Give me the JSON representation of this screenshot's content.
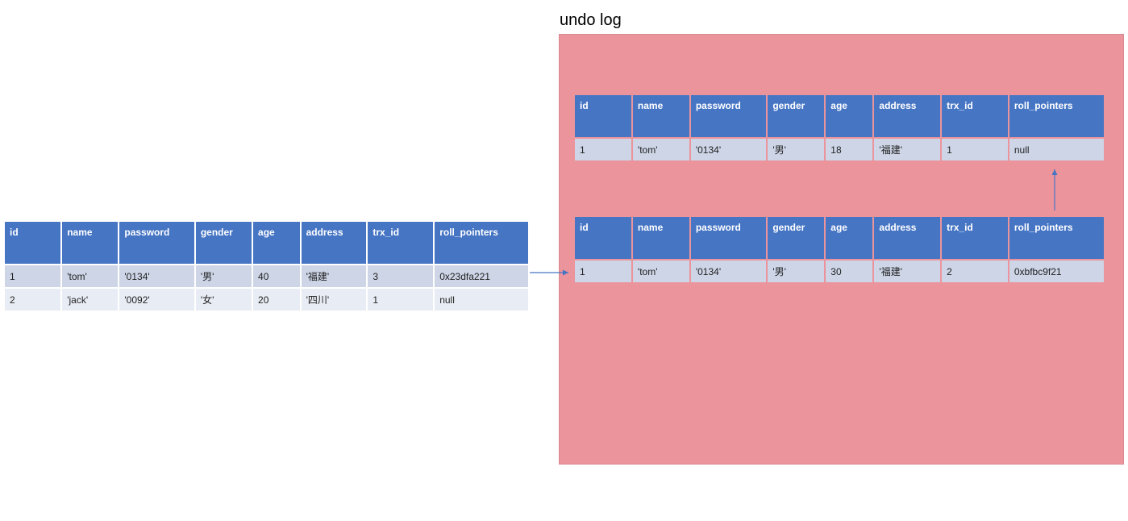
{
  "undo_log_title": "undo log",
  "columns": [
    "id",
    "name",
    "password",
    "gender",
    "age",
    "address",
    "trx_id",
    "roll_pointers"
  ],
  "main_table": {
    "rows": [
      {
        "id": "1",
        "name": "'tom'",
        "password": "'0134'",
        "gender": "'男'",
        "age": "40",
        "address": "'福建'",
        "trx_id": "3",
        "roll_pointers": "0x23dfa221"
      },
      {
        "id": "2",
        "name": "'jack'",
        "password": "'0092'",
        "gender": "'女'",
        "age": "20",
        "address": "'四川'",
        "trx_id": "1",
        "roll_pointers": "null"
      }
    ]
  },
  "undo_table_1": {
    "rows": [
      {
        "id": "1",
        "name": "'tom'",
        "password": "'0134'",
        "gender": "'男'",
        "age": "18",
        "address": "'福建'",
        "trx_id": "1",
        "roll_pointers": "null"
      }
    ]
  },
  "undo_table_2": {
    "rows": [
      {
        "id": "1",
        "name": "'tom'",
        "password": "'0134'",
        "gender": "'男'",
        "age": "30",
        "address": "'福建'",
        "trx_id": "2",
        "roll_pointers": "0xbfbc9f21"
      }
    ]
  }
}
